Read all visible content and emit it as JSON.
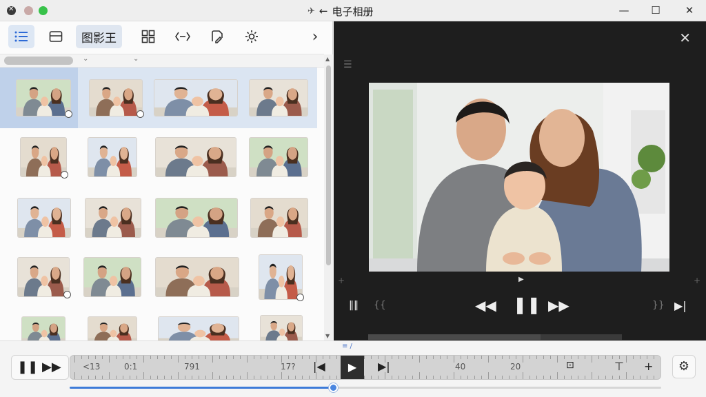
{
  "window": {
    "title": "电子相册",
    "title_icon": "rocket-icon",
    "back_glyph": "←",
    "controls": {
      "minimize": "—",
      "maximize": "☐",
      "close": "✕"
    }
  },
  "toolbar": {
    "items": [
      {
        "name": "list-view-icon",
        "glyph": "☰",
        "active": true
      },
      {
        "name": "folder-icon",
        "glyph": "▭"
      },
      {
        "name": "app-label",
        "label": "图影王"
      },
      {
        "name": "grid-view-icon",
        "glyph": "▦"
      },
      {
        "name": "share-icon",
        "glyph": "⟨⟩"
      },
      {
        "name": "edit-icon",
        "glyph": "✎"
      },
      {
        "name": "settings-icon",
        "glyph": "⚙"
      },
      {
        "name": "chevron-right-icon",
        "glyph": "›"
      }
    ]
  },
  "gallery": {
    "rows": 5,
    "selected_row": 0,
    "selected_col": 0,
    "badge_positions": [
      [
        0,
        0
      ],
      [
        0,
        1
      ],
      [
        1,
        0
      ],
      [
        3,
        0
      ],
      [
        3,
        3
      ]
    ]
  },
  "player": {
    "controls": {
      "bars": "‖‖",
      "bracket_left": "{{",
      "rewind": "◀◀",
      "pause": "❚❚",
      "forward": "▶▶",
      "bracket_right": "}}",
      "skip_end": "▶|",
      "small_play": "▶"
    },
    "progress": 0.68
  },
  "timeline": {
    "pause_glyph": "❚❚",
    "forward_glyph": "▶▶",
    "labels": [
      "<13",
      "0:1",
      "791",
      "17?",
      "40",
      "20"
    ],
    "prev_glyph": "|◀",
    "play_glyph": "▶",
    "next_glyph": "▶|",
    "scrubber_value": 0.445,
    "mark": "≡ /"
  },
  "colors": {
    "accent": "#3d7bd8",
    "selected_row": "#dbe5f2",
    "selected_cell": "#bfd1ea",
    "player_bg": "#1e1e1e"
  }
}
